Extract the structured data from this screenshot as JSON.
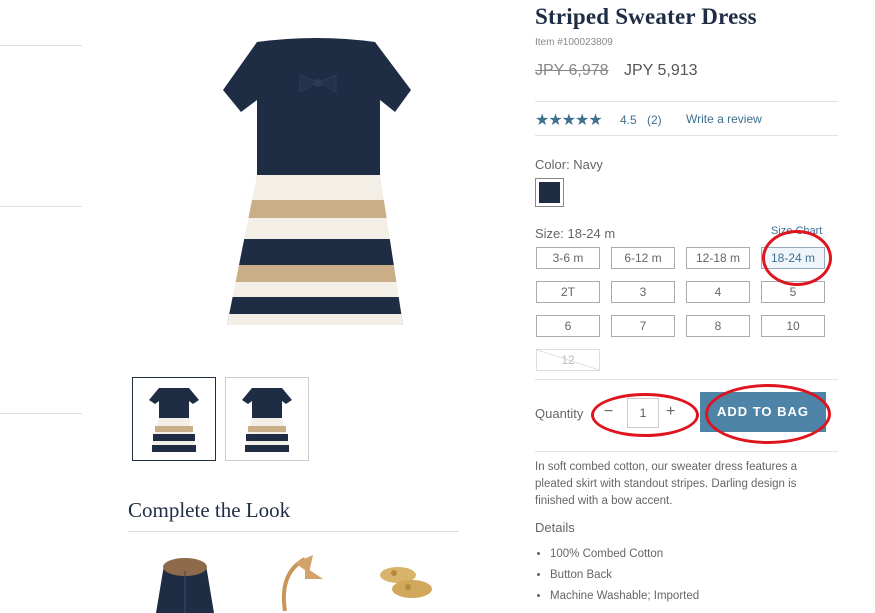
{
  "product": {
    "title": "Striped Sweater Dress",
    "item_number": "Item #100023809",
    "price_original": "JPY 6,978",
    "price_sale": "JPY 5,913"
  },
  "reviews": {
    "stars": "★★★★★",
    "rating": "4.5",
    "count": "(2)",
    "write_review": "Write a review"
  },
  "color": {
    "label": "Color: Navy",
    "swatch_hex": "#1f2d44"
  },
  "size": {
    "label": "Size: 18-24 m",
    "chart_link": "Size Chart",
    "options": [
      "3-6 m",
      "6-12 m",
      "12-18 m",
      "18-24 m",
      "2T",
      "3",
      "4",
      "5",
      "6",
      "7",
      "8",
      "10",
      "12"
    ],
    "selected": "18-24 m",
    "unavailable": [
      "12"
    ]
  },
  "quantity": {
    "label": "Quantity",
    "minus": "−",
    "value": "1",
    "plus": "+"
  },
  "add_to_bag": "ADD TO BAG",
  "description": "In soft combed cotton, our sweater dress features a pleated skirt with standout stripes. Darling design is finished with a bow accent.",
  "details": {
    "title": "Details",
    "items": [
      "100% Combed Cotton",
      "Button Back",
      "Machine Washable; Imported"
    ]
  },
  "complete_the_look": {
    "title": "Complete the Look"
  },
  "colors": {
    "navy": "#1f2d44",
    "accent": "#4d84a7",
    "annotation": "#e0141e"
  }
}
